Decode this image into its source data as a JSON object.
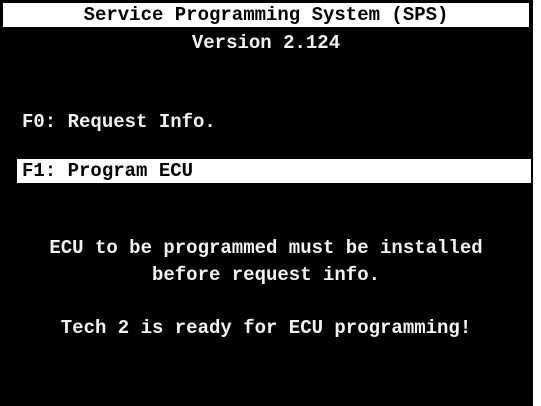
{
  "header": {
    "title": "Service Programming System (SPS)",
    "version": "Version 2.124"
  },
  "menu": {
    "items": [
      {
        "label": "F0: Request Info.",
        "selected": false
      },
      {
        "label": "F1: Program ECU",
        "selected": true
      }
    ]
  },
  "messages": {
    "instruction_line1": "ECU to be programmed must be installed",
    "instruction_line2": "before request info.",
    "status": "Tech 2 is ready for ECU programming!"
  },
  "colors": {
    "screen_background": "#000000",
    "text": "#f2f2f2",
    "highlight": "#ffffff",
    "highlight_text": "#000000"
  }
}
